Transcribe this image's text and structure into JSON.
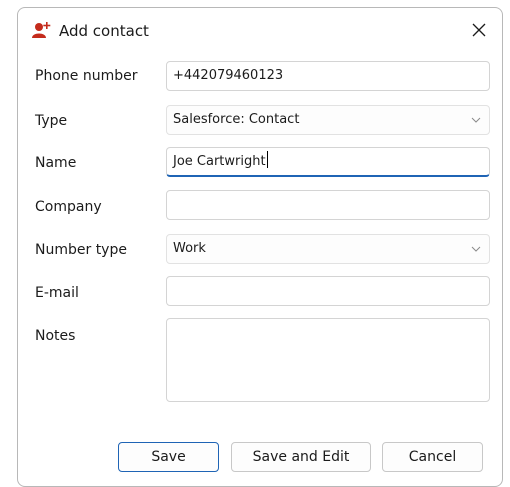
{
  "dialog": {
    "title": "Add contact",
    "title_icon": "person-add-icon",
    "close_icon": "close-icon",
    "accent_color": "#c42b1c",
    "focus_color": "#1f64b5"
  },
  "form": {
    "phone": {
      "label": "Phone number",
      "value": "+442079460123"
    },
    "type": {
      "label": "Type",
      "value": "Salesforce: Contact"
    },
    "name": {
      "label": "Name",
      "value": "Joe Cartwright"
    },
    "company": {
      "label": "Company",
      "value": ""
    },
    "number_type": {
      "label": "Number type",
      "value": "Work"
    },
    "email": {
      "label": "E-mail",
      "value": ""
    },
    "notes": {
      "label": "Notes",
      "value": ""
    }
  },
  "buttons": {
    "save": "Save",
    "save_edit": "Save and Edit",
    "cancel": "Cancel"
  }
}
